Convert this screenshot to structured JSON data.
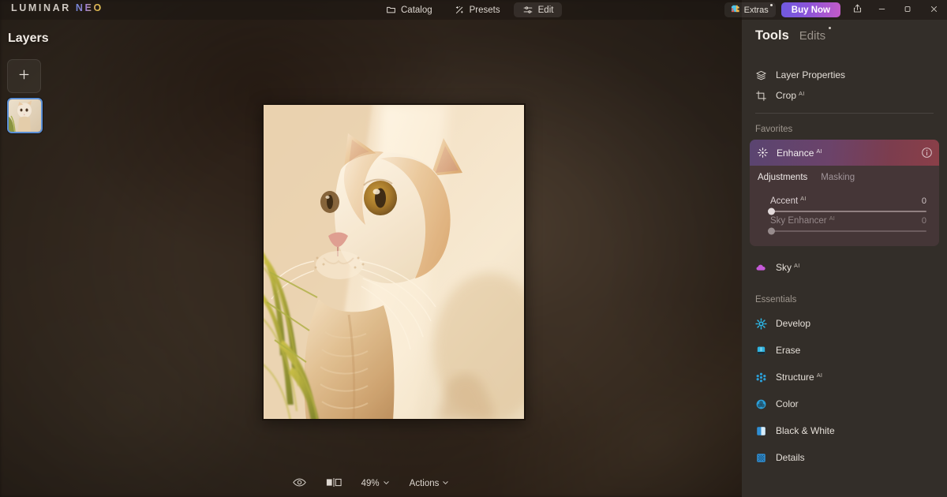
{
  "app": {
    "brand_first": "LUMINAR",
    "brand_second": "NEO"
  },
  "topnav": {
    "items": [
      {
        "label": "Catalog",
        "icon": "folder-icon",
        "active": false
      },
      {
        "label": "Presets",
        "icon": "sparkle-icon",
        "active": false
      },
      {
        "label": "Edit",
        "icon": "sliders-icon",
        "active": true
      }
    ]
  },
  "topright": {
    "extras_label": "Extras",
    "extras_icon": "puzzle-icon",
    "buy_label": "Buy Now",
    "share_icon": "share-icon",
    "minimize_icon": "minimize-icon",
    "maximize_icon": "maximize-icon",
    "close_icon": "close-icon"
  },
  "layers": {
    "title": "Layers",
    "add_icon": "plus-icon",
    "thumbnail_name": "cat-layer-thumbnail"
  },
  "bottombar": {
    "eye_icon": "eye-icon",
    "compare_icon": "before-after-icon",
    "zoom_level": "49%",
    "actions_label": "Actions"
  },
  "tools": {
    "title": "Tools",
    "edits_label": "Edits",
    "top_items": [
      {
        "label": "Layer Properties",
        "ai": "",
        "icon": "layers-icon",
        "color": "#e0dad3"
      },
      {
        "label": "Crop",
        "ai": "AI",
        "icon": "crop-icon",
        "color": "#e0dad3"
      }
    ],
    "favorites_label": "Favorites",
    "enhance": {
      "label": "Enhance",
      "ai": "AI",
      "icon": "enhance-sparkle-icon",
      "info_icon": "info-icon",
      "tabs": [
        {
          "label": "Adjustments",
          "active": true
        },
        {
          "label": "Masking",
          "active": false
        }
      ],
      "sliders": [
        {
          "label": "Accent",
          "ai": "AI",
          "value": "0",
          "position": 0,
          "disabled": false
        },
        {
          "label": "Sky Enhancer",
          "ai": "AI",
          "value": "0",
          "position": 0,
          "disabled": true
        }
      ],
      "gradient_from": "#5a4470",
      "gradient_to": "#8a3f48"
    },
    "sky": {
      "label": "Sky",
      "ai": "AI",
      "icon": "cloud-icon",
      "color": "#c55ad8"
    },
    "essentials_label": "Essentials",
    "essentials": [
      {
        "label": "Develop",
        "ai": "",
        "icon": "develop-icon",
        "color": "#2eb3e0"
      },
      {
        "label": "Erase",
        "ai": "",
        "icon": "erase-icon",
        "color": "#2eb3e0"
      },
      {
        "label": "Structure",
        "ai": "AI",
        "icon": "structure-icon",
        "color": "#2b9fd8"
      },
      {
        "label": "Color",
        "ai": "",
        "icon": "color-icon",
        "color": "#2b9fd8"
      },
      {
        "label": "Black & White",
        "ai": "",
        "icon": "bw-icon",
        "color": "#2f8fd4"
      },
      {
        "label": "Details",
        "ai": "",
        "icon": "details-icon",
        "color": "#2f8fd4"
      }
    ]
  }
}
